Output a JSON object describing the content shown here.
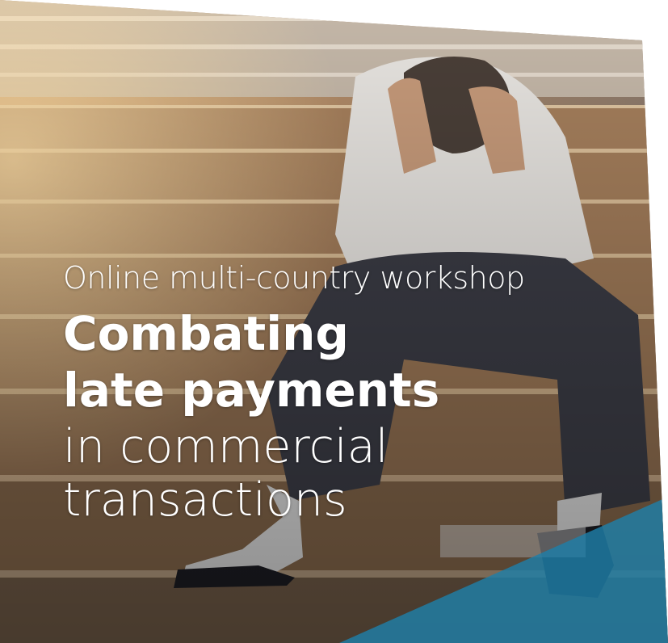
{
  "banner": {
    "subtitle": "Online multi-country workshop",
    "headline_line1": "Combating",
    "headline_line2": "late payments",
    "tagline_line1": "in commercial",
    "tagline_line2": "transactions",
    "colors": {
      "accent_triangle": "#1f7fa8",
      "text": "#ffffff",
      "background": "#ffffff"
    }
  }
}
